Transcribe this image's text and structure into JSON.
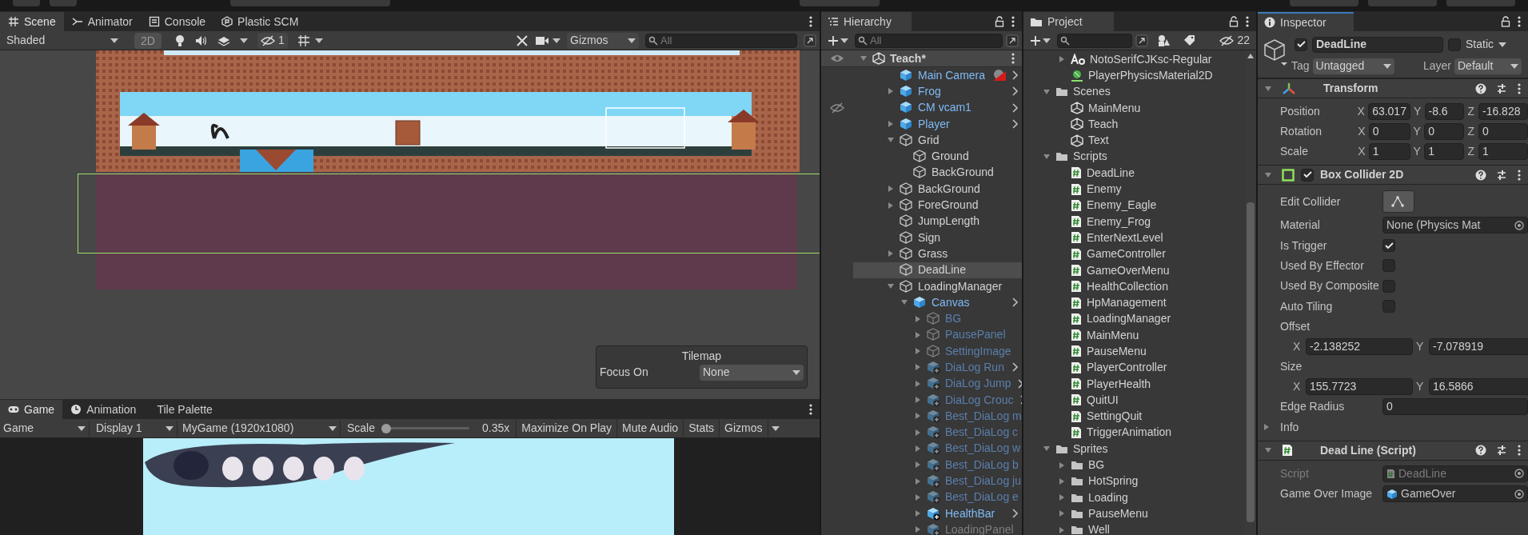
{
  "scene_panel": {
    "tabs": [
      {
        "label": "Scene",
        "selected": true
      },
      {
        "label": "Animator",
        "selected": false
      },
      {
        "label": "Console",
        "selected": false
      },
      {
        "label": "Plastic SCM",
        "selected": false
      }
    ],
    "toolbar": {
      "shading": "Shaded",
      "mode_2d": {
        "label": "2D",
        "on": true
      },
      "hidden_count": "1",
      "gizmos": "Gizmos",
      "search_placeholder": "All"
    },
    "overlay": {
      "title": "Tilemap",
      "label": "Focus On",
      "value": "None"
    }
  },
  "game_panel": {
    "tabs": [
      {
        "label": "Game",
        "selected": true
      },
      {
        "label": "Animation",
        "selected": false
      },
      {
        "label": "Tile Palette",
        "selected": false
      }
    ],
    "toolbar": {
      "view": "Game",
      "display": "Display 1",
      "resolution": "MyGame (1920x1080)",
      "scale_label": "Scale",
      "scale": {
        "level": 0.0
      },
      "scale_value": "0.35x",
      "buttons": [
        "Maximize On Play",
        "Mute Audio",
        "Stats",
        "Gizmos"
      ]
    }
  },
  "hierarchy": {
    "title": "Hierarchy",
    "search_placeholder": "All",
    "scene": {
      "name": "Teach*",
      "expanded": true,
      "children": [
        {
          "name": "Main Camera",
          "kind": "prefab",
          "linked": true,
          "active": true,
          "selected": false,
          "gizmo": true
        },
        {
          "name": "Frog",
          "kind": "prefab",
          "linked": true,
          "active": true,
          "selected": false,
          "expanded": false
        },
        {
          "name": "CM vcam1",
          "kind": "prefab",
          "linked": true,
          "active": true,
          "selected": false,
          "hidden": true
        },
        {
          "name": "Player",
          "kind": "prefab",
          "linked": true,
          "active": true,
          "selected": false,
          "expanded": false
        },
        {
          "name": "Grid",
          "kind": "object",
          "linked": false,
          "active": true,
          "selected": false,
          "expanded": true,
          "children": [
            {
              "name": "Ground",
              "kind": "object",
              "linked": false,
              "active": true,
              "selected": false
            },
            {
              "name": "BackGround",
              "kind": "object",
              "linked": false,
              "active": true,
              "selected": false
            }
          ]
        },
        {
          "name": "BackGround",
          "kind": "object",
          "linked": false,
          "active": true,
          "selected": false,
          "expanded": false
        },
        {
          "name": "ForeGround",
          "kind": "object",
          "linked": false,
          "active": true,
          "selected": false,
          "expanded": false
        },
        {
          "name": "JumpLength",
          "kind": "object",
          "linked": false,
          "active": true,
          "selected": false
        },
        {
          "name": "Sign",
          "kind": "object",
          "linked": false,
          "active": true,
          "selected": false
        },
        {
          "name": "Grass",
          "kind": "object",
          "linked": false,
          "active": true,
          "selected": false,
          "expanded": false
        },
        {
          "name": "DeadLine",
          "kind": "object",
          "linked": false,
          "active": true,
          "selected": true
        },
        {
          "name": "LoadingManager",
          "kind": "object",
          "linked": false,
          "active": true,
          "selected": false,
          "expanded": true,
          "children": [
            {
              "name": "Canvas",
              "kind": "prefab",
              "linked": true,
              "active": true,
              "selected": false,
              "expanded": true,
              "children": [
                {
                  "name": "BG",
                  "kind": "object",
                  "linked": true,
                  "active": false,
                  "selected": false,
                  "expanded": false
                },
                {
                  "name": "PausePanel",
                  "kind": "object",
                  "linked": true,
                  "active": false,
                  "selected": false,
                  "expanded": false
                },
                {
                  "name": "SettingImage",
                  "kind": "object",
                  "linked": true,
                  "active": false,
                  "selected": false,
                  "expanded": false
                },
                {
                  "name": "DiaLog Run",
                  "kind": "added",
                  "linked": true,
                  "active": false,
                  "selected": false,
                  "expanded": false
                },
                {
                  "name": "DiaLog Jump",
                  "kind": "added",
                  "linked": true,
                  "active": false,
                  "selected": false,
                  "expanded": false
                },
                {
                  "name": "DiaLog Crouc",
                  "kind": "added",
                  "linked": true,
                  "active": false,
                  "selected": false,
                  "expanded": false
                },
                {
                  "name": "Best_DiaLog m",
                  "kind": "added",
                  "linked": true,
                  "active": false,
                  "selected": false,
                  "expanded": false
                },
                {
                  "name": "Best_DiaLog c",
                  "kind": "added",
                  "linked": true,
                  "active": false,
                  "selected": false,
                  "expanded": false
                },
                {
                  "name": "Best_DiaLog w",
                  "kind": "added",
                  "linked": true,
                  "active": false,
                  "selected": false,
                  "expanded": false
                },
                {
                  "name": "Best_DiaLog b",
                  "kind": "added",
                  "linked": true,
                  "active": false,
                  "selected": false,
                  "expanded": false
                },
                {
                  "name": "Best_DiaLog ju",
                  "kind": "added",
                  "linked": true,
                  "active": false,
                  "selected": false,
                  "expanded": false
                },
                {
                  "name": "Best_DiaLog e",
                  "kind": "added",
                  "linked": true,
                  "active": false,
                  "selected": false,
                  "expanded": false
                },
                {
                  "name": "HealthBar",
                  "kind": "added",
                  "linked": true,
                  "active": true,
                  "selected": false,
                  "expanded": false
                },
                {
                  "name": "LoadingPanel",
                  "kind": "added",
                  "linked": false,
                  "active": false,
                  "selected": false,
                  "expanded": false
                }
              ]
            }
          ]
        }
      ]
    }
  },
  "project": {
    "title": "Project",
    "hidden_count": "22",
    "items": [
      {
        "children": [
          {
            "name": "NotoSerifCJKsc-Regular",
            "kind": "font",
            "expanded": false
          },
          {
            "name": "PlayerPhysicsMaterial2D",
            "kind": "physics"
          }
        ]
      },
      {
        "name": "Scenes",
        "kind": "folder",
        "expanded": true,
        "children": [
          {
            "name": "MainMenu",
            "kind": "scene"
          },
          {
            "name": "Teach",
            "kind": "scene"
          },
          {
            "name": "Text",
            "kind": "scene"
          }
        ]
      },
      {
        "name": "Scripts",
        "kind": "folder",
        "expanded": true,
        "children": [
          {
            "name": "DeadLine",
            "kind": "script"
          },
          {
            "name": "Enemy",
            "kind": "script"
          },
          {
            "name": "Enemy_Eagle",
            "kind": "script"
          },
          {
            "name": "Enemy_Frog",
            "kind": "script"
          },
          {
            "name": "EnterNextLevel",
            "kind": "script"
          },
          {
            "name": "GameController",
            "kind": "script"
          },
          {
            "name": "GameOverMenu",
            "kind": "script"
          },
          {
            "name": "HealthCollection",
            "kind": "script"
          },
          {
            "name": "HpManagement",
            "kind": "script"
          },
          {
            "name": "LoadingManager",
            "kind": "script"
          },
          {
            "name": "MainMenu",
            "kind": "script"
          },
          {
            "name": "PauseMenu",
            "kind": "script"
          },
          {
            "name": "PlayerController",
            "kind": "script"
          },
          {
            "name": "PlayerHealth",
            "kind": "script"
          },
          {
            "name": "QuitUI",
            "kind": "script"
          },
          {
            "name": "SettingQuit",
            "kind": "script"
          },
          {
            "name": "TriggerAnimation",
            "kind": "script"
          }
        ]
      },
      {
        "name": "Sprites",
        "kind": "folder",
        "expanded": true,
        "children": [
          {
            "name": "BG",
            "kind": "folder",
            "expanded": false
          },
          {
            "name": "HotSpring",
            "kind": "folder",
            "expanded": false
          },
          {
            "name": "Loading",
            "kind": "folder",
            "expanded": false
          },
          {
            "name": "PauseMenu",
            "kind": "folder",
            "expanded": false
          },
          {
            "name": "Well",
            "kind": "folder",
            "expanded": false
          }
        ]
      }
    ]
  },
  "inspector": {
    "title": "Inspector",
    "object": {
      "active": true,
      "name": "DeadLine",
      "static": false,
      "static_label": "Static",
      "tag_label": "Tag",
      "tag": "Untagged",
      "layer_label": "Layer",
      "layer": "Default"
    },
    "components": [
      {
        "kind": "transform",
        "title": "Transform",
        "expanded": true,
        "rows": [
          {
            "label": "Position",
            "values": [
              {
                "axis": "X",
                "value": "63.017"
              },
              {
                "axis": "Y",
                "value": "-8.6"
              },
              {
                "axis": "Z",
                "value": "-16.828"
              }
            ]
          },
          {
            "label": "Rotation",
            "values": [
              {
                "axis": "X",
                "value": "0"
              },
              {
                "axis": "Y",
                "value": "0"
              },
              {
                "axis": "Z",
                "value": "0"
              }
            ]
          },
          {
            "label": "Scale",
            "values": [
              {
                "axis": "X",
                "value": "1"
              },
              {
                "axis": "Y",
                "value": "1"
              },
              {
                "axis": "Z",
                "value": "1"
              }
            ]
          }
        ]
      },
      {
        "kind": "collider",
        "title": "Box Collider 2D",
        "expanded": true,
        "enabled": true,
        "fields": [
          {
            "kind": "button",
            "label": "Edit Collider"
          },
          {
            "kind": "object",
            "label": "Material",
            "value": "None (Physics Mat"
          },
          {
            "kind": "toggle",
            "label": "Is Trigger",
            "checked": true
          },
          {
            "kind": "toggle",
            "label": "Used By Effector",
            "checked": false
          },
          {
            "kind": "toggle",
            "label": "Used By Composite",
            "checked": false
          },
          {
            "kind": "toggle",
            "label": "Auto Tiling",
            "checked": false
          },
          {
            "kind": "vector",
            "label": "Offset",
            "values": [
              {
                "axis": "X",
                "value": "-2.138252"
              },
              {
                "axis": "Y",
                "value": "-7.078919"
              }
            ]
          },
          {
            "kind": "vector",
            "label": "Size",
            "values": [
              {
                "axis": "X",
                "value": "155.7723"
              },
              {
                "axis": "Y",
                "value": "16.5866"
              }
            ]
          },
          {
            "kind": "number",
            "label": "Edge Radius",
            "value": "0"
          },
          {
            "kind": "foldout",
            "label": "Info",
            "expanded": false
          }
        ]
      },
      {
        "kind": "script",
        "title": "Dead Line (Script)",
        "expanded": true,
        "fields": [
          {
            "kind": "object",
            "label": "Script",
            "value": "DeadLine",
            "disabled": true
          },
          {
            "kind": "object",
            "label": "Game Over Image",
            "value": "GameOver",
            "disabled": false
          }
        ]
      }
    ]
  }
}
